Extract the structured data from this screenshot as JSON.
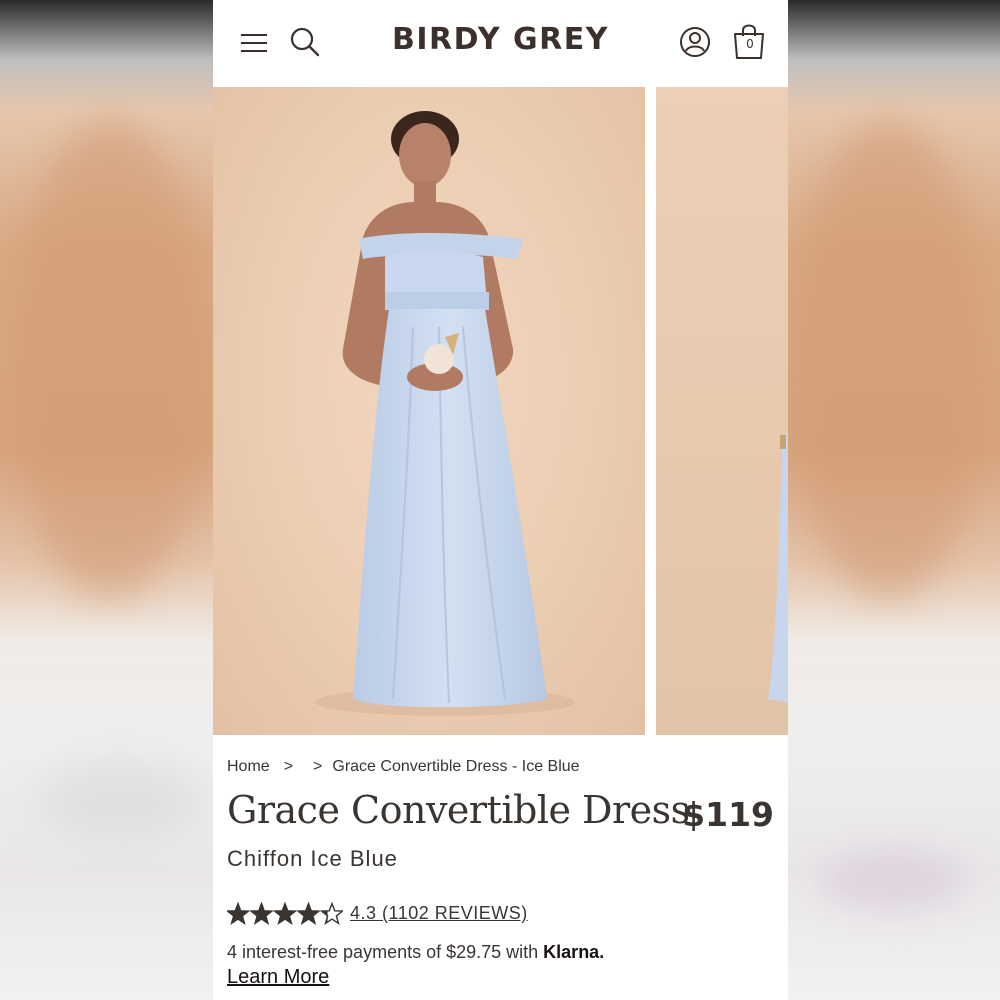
{
  "header": {
    "brand": "BIRDY GREY",
    "cart_count": "0"
  },
  "icons": {
    "menu": "hamburger-menu-icon",
    "search": "search-icon",
    "account": "account-icon",
    "bag": "shopping-bag-icon"
  },
  "colors": {
    "text": "#3b3532",
    "dress": "#c9d8ee",
    "backdrop": "#ebcdb2"
  },
  "breadcrumb": {
    "home": "Home",
    "sep1": ">",
    "sep2": ">",
    "current": "Grace Convertible Dress - Ice Blue"
  },
  "product": {
    "title": "Grace Convertible Dress",
    "price": "$119",
    "subtitle": "Chiffon Ice Blue",
    "rating": 4.3,
    "reviews_text": "4.3 (1102 REVIEWS)"
  },
  "payment": {
    "text": "4 interest-free payments of $29.75 with ",
    "provider": "Klarna.",
    "learn_more": "Learn More"
  }
}
